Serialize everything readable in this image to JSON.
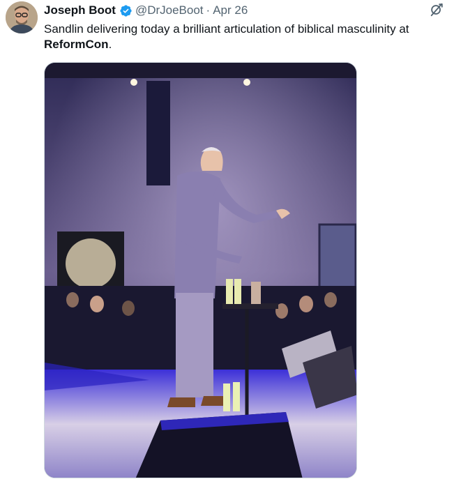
{
  "author": {
    "name": "Joseph Boot",
    "handle": "@DrJoeBoot",
    "separator": "·",
    "date": "Apr 26"
  },
  "tweet": {
    "text_before": "Sandlin delivering today a brilliant articulation of biblical masculinity at ",
    "text_bold": "ReformCon",
    "text_after": "."
  },
  "icons": {
    "verified": "verified-badge-icon",
    "grok": "grok-icon"
  },
  "colors": {
    "verified_blue": "#1d9bf0",
    "secondary_text": "#536471",
    "stage_light": "#4a3df0"
  }
}
